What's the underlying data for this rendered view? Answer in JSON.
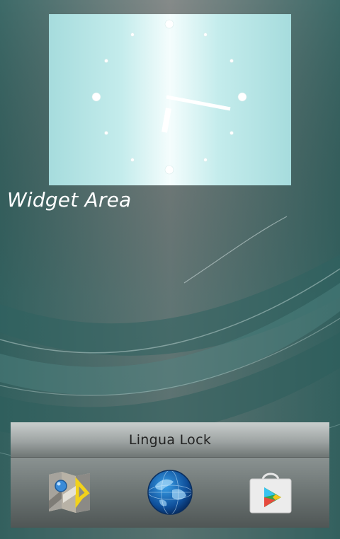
{
  "clock_widget": {
    "hour_markers": 12
  },
  "widget_area": {
    "label": "Widget Area"
  },
  "lock_bar": {
    "label": "Lingua Lock"
  },
  "dock": {
    "apps": [
      {
        "icon": "maps-icon"
      },
      {
        "icon": "globe-icon"
      },
      {
        "icon": "play-store-icon"
      }
    ]
  },
  "colors": {
    "clock_face": "#c4ecec",
    "clock_hands": "#ffffff",
    "wallpaper_teal": "#3f6e6c"
  }
}
